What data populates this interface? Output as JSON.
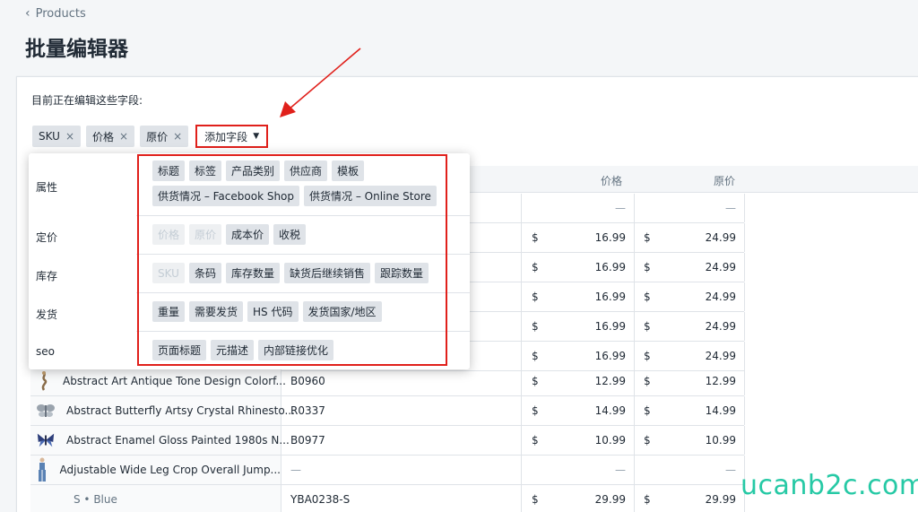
{
  "nav": {
    "back_label": "Products"
  },
  "page": {
    "title": "批量编辑器",
    "editing_label": "目前正在编辑这些字段:"
  },
  "chips": [
    {
      "label": "SKU"
    },
    {
      "label": "价格"
    },
    {
      "label": "原价"
    }
  ],
  "add_field": {
    "label": "添加字段"
  },
  "table": {
    "headers": {
      "price": "价格",
      "compare": "原价"
    },
    "rows": [
      {
        "name": "Abstract Art Antique Tone Design Colorf...",
        "sku": "B0960",
        "currency": "$",
        "price": "12.99",
        "compare": "12.99"
      },
      {
        "name": "Abstract Butterfly Artsy Crystal Rhinesto...",
        "sku": "R0337",
        "currency": "$",
        "price": "14.99",
        "compare": "14.99"
      },
      {
        "name": "Abstract Enamel Gloss Painted 1980s N...",
        "sku": "B0977",
        "currency": "$",
        "price": "10.99",
        "compare": "10.99"
      },
      {
        "name": "Adjustable Wide Leg Crop Overall Jump...",
        "sku": "—",
        "price_dash": "—",
        "compare_dash": "—"
      },
      {
        "variant": "S • Blue",
        "sku": "YBA0238-S",
        "currency": "$",
        "price": "29.99",
        "compare": "29.99"
      }
    ],
    "hidden_rows": [
      {
        "currency": "$",
        "price": "16.99",
        "compare": "24.99"
      },
      {
        "currency": "$",
        "price": "16.99",
        "compare": "24.99"
      },
      {
        "currency": "$",
        "price": "16.99",
        "compare": "24.99"
      },
      {
        "currency": "$",
        "price": "16.99",
        "compare": "24.99"
      },
      {
        "currency": "$",
        "price": "16.99",
        "compare": "24.99"
      }
    ],
    "top_dash": "—"
  },
  "dropdown": {
    "categories": {
      "attributes": {
        "label": "属性",
        "options": [
          "标题",
          "标签",
          "产品类别",
          "供应商",
          "模板",
          "供货情况 – Facebook Shop",
          "供货情况 – Online Store"
        ]
      },
      "pricing": {
        "label": "定价",
        "options": [
          "价格",
          "原价",
          "成本价",
          "收税"
        ]
      },
      "inventory": {
        "label": "库存",
        "options": [
          "SKU",
          "条码",
          "库存数量",
          "缺货后继续销售",
          "跟踪数量"
        ]
      },
      "shipping": {
        "label": "发货",
        "options": [
          "重量",
          "需要发货",
          "HS 代码",
          "发货国家/地区"
        ]
      },
      "seo": {
        "label": "seo",
        "options": [
          "页面标题",
          "元描述",
          "内部链接优化"
        ]
      }
    }
  },
  "watermark": "ucanb2c.com",
  "colors": {
    "highlight": "#e0201b",
    "watermark": "#26c9a5"
  }
}
